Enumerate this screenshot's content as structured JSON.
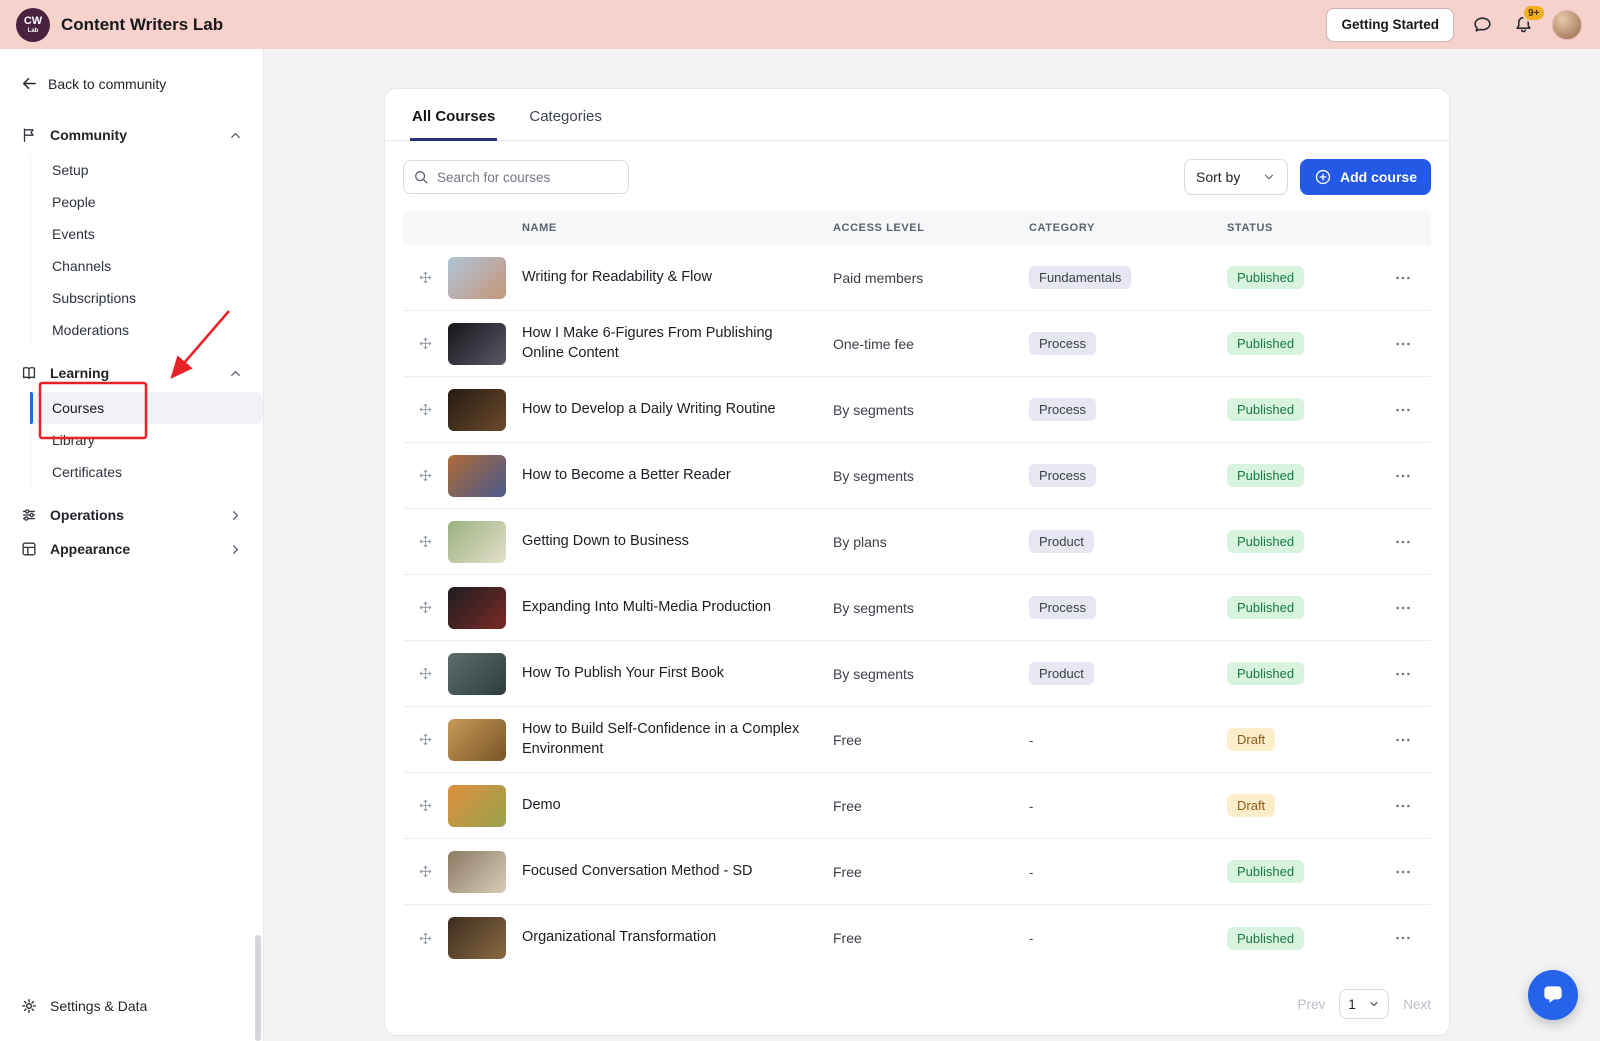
{
  "header": {
    "logo": {
      "line1": "CW",
      "line2": "Lab"
    },
    "title": "Content Writers Lab",
    "getting_started": "Getting Started",
    "notification_count": "9+"
  },
  "sidebar": {
    "back": "Back to community",
    "community": {
      "label": "Community",
      "items": [
        "Setup",
        "People",
        "Events",
        "Channels",
        "Subscriptions",
        "Moderations"
      ]
    },
    "learning": {
      "label": "Learning",
      "items": [
        "Courses",
        "Library",
        "Certificates"
      ],
      "active_item": "Courses"
    },
    "operations": {
      "label": "Operations"
    },
    "appearance": {
      "label": "Appearance"
    },
    "settings": "Settings & Data"
  },
  "tabs": {
    "all_courses": "All Courses",
    "categories": "Categories"
  },
  "toolbar": {
    "search_placeholder": "Search for courses",
    "sort_by": "Sort by",
    "add_course": "Add course"
  },
  "table": {
    "headers": {
      "name": "NAME",
      "access": "ACCESS LEVEL",
      "category": "CATEGORY",
      "status": "STATUS"
    },
    "rows": [
      {
        "name": "Writing for Readability & Flow",
        "access": "Paid members",
        "category": "Fundamentals",
        "status": "Published",
        "thumb": [
          "#aec4d6",
          "#c59579"
        ]
      },
      {
        "name": "How I Make 6-Figures From Publishing Online Content",
        "access": "One-time fee",
        "category": "Process",
        "status": "Published",
        "thumb": [
          "#15151a",
          "#5a5a66"
        ]
      },
      {
        "name": "How to Develop a Daily Writing Routine",
        "access": "By segments",
        "category": "Process",
        "status": "Published",
        "thumb": [
          "#241a12",
          "#6d4b2c"
        ]
      },
      {
        "name": "How to Become a Better Reader",
        "access": "By segments",
        "category": "Process",
        "status": "Published",
        "thumb": [
          "#b06a3a",
          "#4a5a8a"
        ]
      },
      {
        "name": "Getting Down to Business",
        "access": "By plans",
        "category": "Product",
        "status": "Published",
        "thumb": [
          "#9ab07e",
          "#e4e0cc"
        ]
      },
      {
        "name": "Expanding Into Multi-Media Production",
        "access": "By segments",
        "category": "Process",
        "status": "Published",
        "thumb": [
          "#1d1d22",
          "#7a2a24"
        ]
      },
      {
        "name": "How To Publish Your First Book",
        "access": "By segments",
        "category": "Product",
        "status": "Published",
        "thumb": [
          "#5d6e6c",
          "#2e3c3e"
        ]
      },
      {
        "name": "How to Build Self-Confidence in a Complex Environment",
        "access": "Free",
        "category": "-",
        "status": "Draft",
        "thumb": [
          "#c79a58",
          "#7a5426"
        ]
      },
      {
        "name": "Demo",
        "access": "Free",
        "category": "-",
        "status": "Draft",
        "thumb": [
          "#e08f3c",
          "#97a24d"
        ]
      },
      {
        "name": "Focused Conversation Method - SD",
        "access": "Free",
        "category": "-",
        "status": "Published",
        "thumb": [
          "#8b7a62",
          "#d9cdb8"
        ]
      },
      {
        "name": "Organizational Transformation",
        "access": "Free",
        "category": "-",
        "status": "Published",
        "thumb": [
          "#3c2c1e",
          "#8a6a42"
        ]
      }
    ]
  },
  "pagination": {
    "prev": "Prev",
    "page": "1",
    "next": "Next"
  },
  "colors": {
    "header_bg": "#f7d1cc",
    "accent_blue": "#2458e6",
    "active_tab_underline": "#27357e",
    "published_bg": "#d8f3de",
    "published_text": "#177a41",
    "draft_bg": "#fdeecb",
    "draft_text": "#8a5a14",
    "category_badge_bg": "#e6e7f2",
    "annotation_red": "#e82127",
    "notification_badge_bg": "#f3b01c"
  }
}
